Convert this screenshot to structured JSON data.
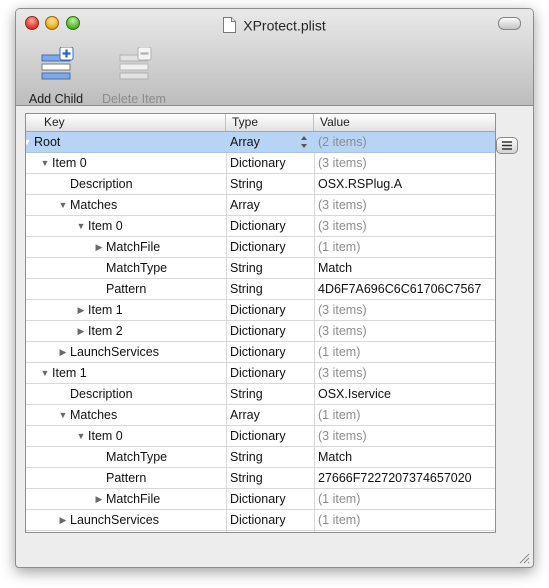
{
  "window": {
    "title": "XProtect.plist"
  },
  "toolbar": {
    "add_child_label": "Add Child",
    "delete_item_label": "Delete Item"
  },
  "columns": {
    "key": "Key",
    "type": "Type",
    "value": "Value"
  },
  "rows": [
    {
      "key": "Root",
      "type": "Array",
      "value": "(2 items)",
      "value_muted": true,
      "level": 0,
      "disclosure": "expanded",
      "selected": true,
      "stepper": true
    },
    {
      "key": "Item 0",
      "type": "Dictionary",
      "value": "(3 items)",
      "value_muted": true,
      "level": 1,
      "disclosure": "expanded"
    },
    {
      "key": "Description",
      "type": "String",
      "value": "OSX.RSPlug.A",
      "level": 2,
      "disclosure": "none"
    },
    {
      "key": "Matches",
      "type": "Array",
      "value": "(3 items)",
      "value_muted": true,
      "level": 2,
      "disclosure": "expanded"
    },
    {
      "key": "Item 0",
      "type": "Dictionary",
      "value": "(3 items)",
      "value_muted": true,
      "level": 3,
      "disclosure": "expanded"
    },
    {
      "key": "MatchFile",
      "type": "Dictionary",
      "value": "(1 item)",
      "value_muted": true,
      "level": 4,
      "disclosure": "collapsed"
    },
    {
      "key": "MatchType",
      "type": "String",
      "value": "Match",
      "level": 4,
      "disclosure": "none"
    },
    {
      "key": "Pattern",
      "type": "String",
      "value": "4D6F7A696C6C61706C7567",
      "level": 4,
      "disclosure": "none"
    },
    {
      "key": "Item 1",
      "type": "Dictionary",
      "value": "(3 items)",
      "value_muted": true,
      "level": 3,
      "disclosure": "collapsed"
    },
    {
      "key": "Item 2",
      "type": "Dictionary",
      "value": "(3 items)",
      "value_muted": true,
      "level": 3,
      "disclosure": "collapsed"
    },
    {
      "key": "LaunchServices",
      "type": "Dictionary",
      "value": "(1 item)",
      "value_muted": true,
      "level": 2,
      "disclosure": "collapsed"
    },
    {
      "key": "Item 1",
      "type": "Dictionary",
      "value": "(3 items)",
      "value_muted": true,
      "level": 1,
      "disclosure": "expanded"
    },
    {
      "key": "Description",
      "type": "String",
      "value": "OSX.Iservice",
      "level": 2,
      "disclosure": "none"
    },
    {
      "key": "Matches",
      "type": "Array",
      "value": "(1 item)",
      "value_muted": true,
      "level": 2,
      "disclosure": "expanded"
    },
    {
      "key": "Item 0",
      "type": "Dictionary",
      "value": "(3 items)",
      "value_muted": true,
      "level": 3,
      "disclosure": "expanded"
    },
    {
      "key": "MatchType",
      "type": "String",
      "value": "Match",
      "level": 4,
      "disclosure": "none"
    },
    {
      "key": "Pattern",
      "type": "String",
      "value": "27666F7227207374657020",
      "level": 4,
      "disclosure": "none"
    },
    {
      "key": "MatchFile",
      "type": "Dictionary",
      "value": "(1 item)",
      "value_muted": true,
      "level": 4,
      "disclosure": "collapsed"
    },
    {
      "key": "LaunchServices",
      "type": "Dictionary",
      "value": "(1 item)",
      "value_muted": true,
      "level": 2,
      "disclosure": "collapsed"
    }
  ],
  "colors": {
    "selection": "#b7d4f5",
    "muted_text": "#8c8c8c"
  },
  "icons": {
    "add_child": "add-child-icon",
    "delete_item": "delete-item-icon",
    "document": "document-icon",
    "row_action": "row-action-icon"
  }
}
